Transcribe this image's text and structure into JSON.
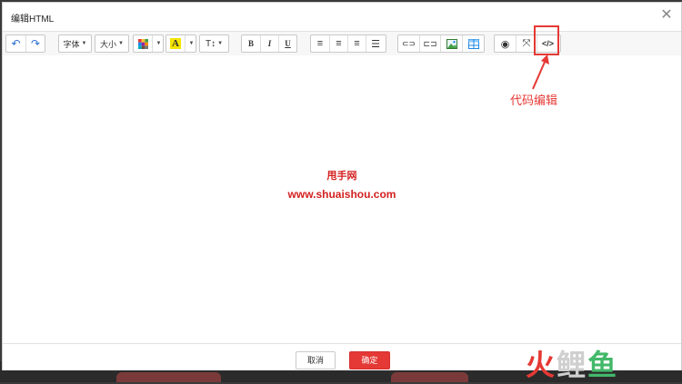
{
  "dialog": {
    "title": "编辑HTML"
  },
  "toolbar": {
    "font_label": "字体",
    "size_label": "大小",
    "bold": "B",
    "italic": "I",
    "underline": "U",
    "heading_label": "T↕"
  },
  "editor": {
    "line1": "甩手网",
    "line2": "www.shuaishou.com"
  },
  "footer": {
    "cancel_label": "取消",
    "ok_label": "确定"
  },
  "annotation": {
    "label": "代码编辑"
  },
  "watermark": {
    "text_a": "火",
    "text_b": "鲤",
    "text_c": "鱼"
  },
  "colors": {
    "accent": "#e53935",
    "logo_green": "#43b86a"
  }
}
